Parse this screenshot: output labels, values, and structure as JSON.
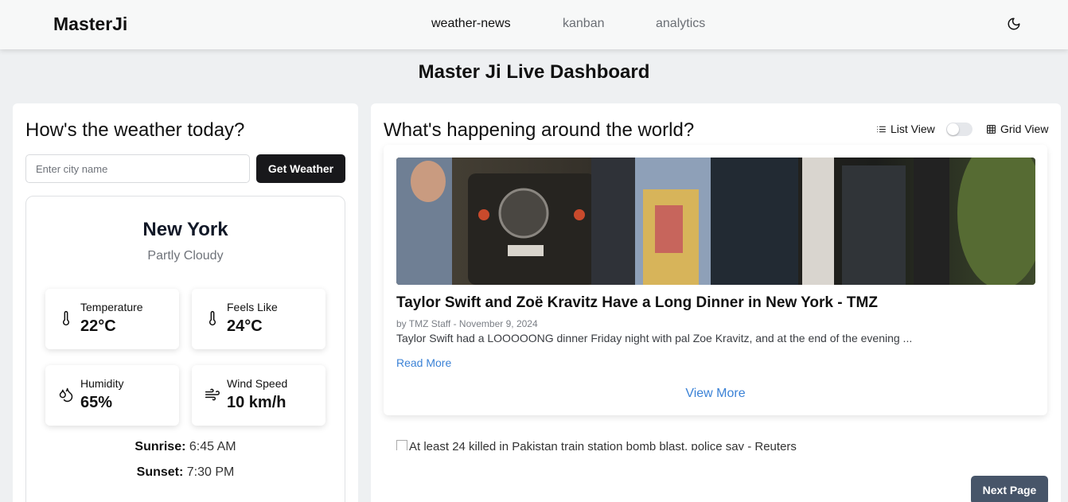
{
  "nav": {
    "brand": "MasterJi",
    "links": [
      "weather-news",
      "kanban",
      "analytics"
    ],
    "theme_icon": "moon-icon"
  },
  "page": {
    "title": "Master Ji Live Dashboard"
  },
  "weather": {
    "heading": "How's the weather today?",
    "input_placeholder": "Enter city name",
    "input_value": "",
    "button_label": "Get Weather",
    "city": "New York",
    "condition": "Partly Cloudy",
    "stats": [
      {
        "label": "Temperature",
        "value": "22°C",
        "icon": "thermometer-icon"
      },
      {
        "label": "Feels Like",
        "value": "24°C",
        "icon": "thermometer-icon"
      },
      {
        "label": "Humidity",
        "value": "65%",
        "icon": "droplets-icon"
      },
      {
        "label": "Wind Speed",
        "value": "10 km/h",
        "icon": "wind-icon"
      }
    ],
    "sunrise_label": "Sunrise:",
    "sunrise": "6:45 AM",
    "sunset_label": "Sunset:",
    "sunset": "7:30 PM"
  },
  "news": {
    "heading": "What's happening around the world?",
    "list_view_label": "List View",
    "grid_view_label": "Grid View",
    "grid_view_enabled": false,
    "article": {
      "title": "Taylor Swift and Zoë Kravitz Have a Long Dinner in New York - TMZ",
      "meta": "by TMZ Staff - November 9, 2024",
      "description": "Taylor Swift had a LOOOOONG dinner Friday night with pal Zoe Kravitz, and at the end of the evening ...",
      "read_more": "Read More",
      "image_icon": "news-photo"
    },
    "view_more": "View More",
    "next_article_alt": "At least 24 killed in Pakistan train station bomb blast, police say - Reuters",
    "next_page": "Next Page"
  },
  "colors": {
    "background": "#eef0f2",
    "primary_button": "#18181b",
    "link": "#3b82d6",
    "next_button": "#475569"
  }
}
